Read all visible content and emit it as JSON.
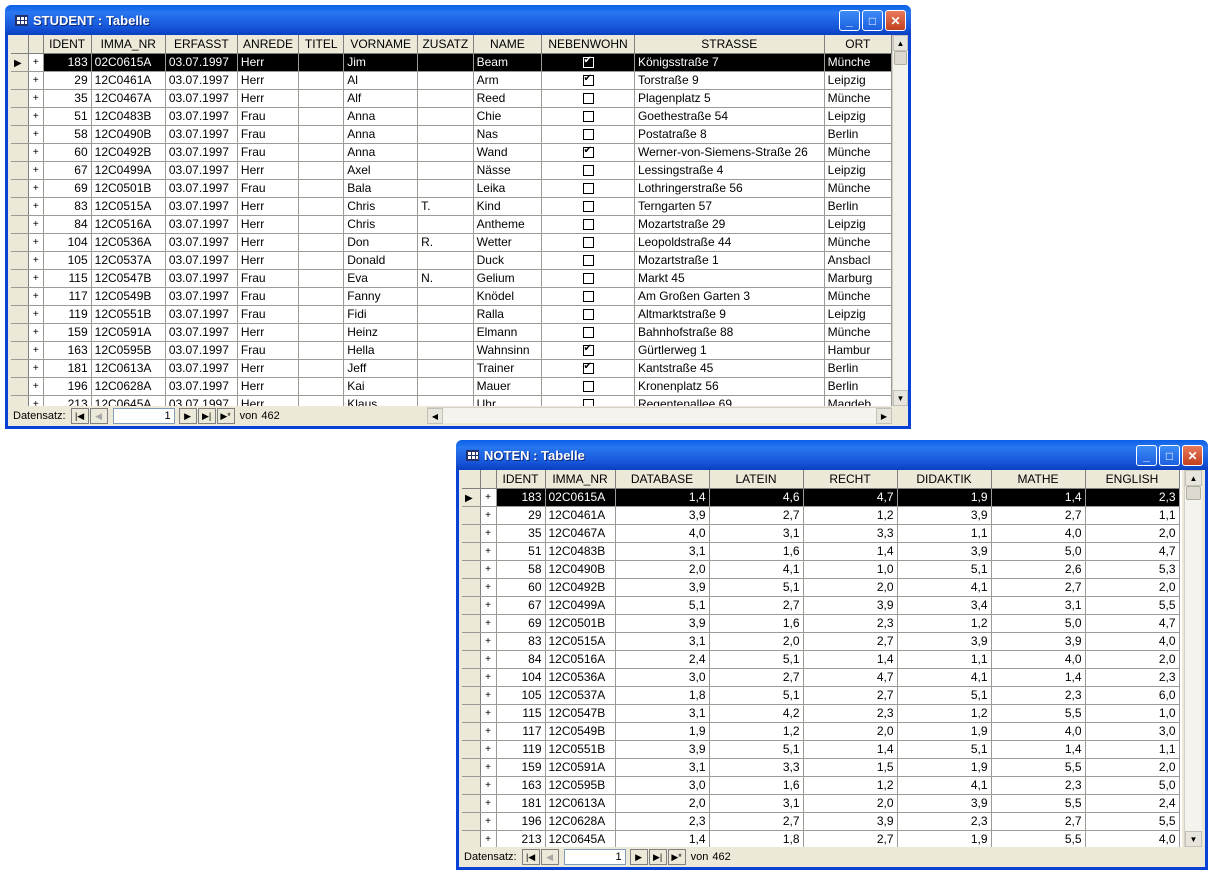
{
  "student": {
    "title": "STUDENT : Tabelle",
    "columns": [
      "IDENT",
      "IMMA_NR",
      "ERFASST",
      "ANREDE",
      "TITEL",
      "VORNAME",
      "ZUSATZ",
      "NAME",
      "NEBENWOHN",
      "STRASSE",
      "ORT"
    ],
    "rows": [
      [
        "183",
        "02C0615A",
        "03.07.1997",
        "Herr",
        "",
        "Jim",
        "",
        "Beam",
        true,
        "Königsstraße 7",
        "Münche"
      ],
      [
        "29",
        "12C0461A",
        "03.07.1997",
        "Herr",
        "",
        "Al",
        "",
        "Arm",
        true,
        "Torstraße 9",
        "Leipzig"
      ],
      [
        "35",
        "12C0467A",
        "03.07.1997",
        "Herr",
        "",
        "Alf",
        "",
        "Reed",
        false,
        "Plagenplatz 5",
        "Münche"
      ],
      [
        "51",
        "12C0483B",
        "03.07.1997",
        "Frau",
        "",
        "Anna",
        "",
        "Chie",
        false,
        "Goethestraße 54",
        "Leipzig"
      ],
      [
        "58",
        "12C0490B",
        "03.07.1997",
        "Frau",
        "",
        "Anna",
        "",
        "Nas",
        false,
        "Postatraße 8",
        "Berlin"
      ],
      [
        "60",
        "12C0492B",
        "03.07.1997",
        "Frau",
        "",
        "Anna",
        "",
        "Wand",
        true,
        "Werner-von-Siemens-Straße 26",
        "Münche"
      ],
      [
        "67",
        "12C0499A",
        "03.07.1997",
        "Herr",
        "",
        "Axel",
        "",
        "Nässe",
        false,
        "Lessingstraße 4",
        "Leipzig"
      ],
      [
        "69",
        "12C0501B",
        "03.07.1997",
        "Frau",
        "",
        "Bala",
        "",
        "Leika",
        false,
        "Lothringerstraße 56",
        "Münche"
      ],
      [
        "83",
        "12C0515A",
        "03.07.1997",
        "Herr",
        "",
        "Chris",
        "T.",
        "Kind",
        false,
        "Terngarten 57",
        "Berlin"
      ],
      [
        "84",
        "12C0516A",
        "03.07.1997",
        "Herr",
        "",
        "Chris",
        "",
        "Antheme",
        false,
        "Mozartstraße 29",
        "Leipzig"
      ],
      [
        "104",
        "12C0536A",
        "03.07.1997",
        "Herr",
        "",
        "Don",
        "R.",
        "Wetter",
        false,
        "Leopoldstraße 44",
        "Münche"
      ],
      [
        "105",
        "12C0537A",
        "03.07.1997",
        "Herr",
        "",
        "Donald",
        "",
        "Duck",
        false,
        "Mozartstraße 1",
        "Ansbacl"
      ],
      [
        "115",
        "12C0547B",
        "03.07.1997",
        "Frau",
        "",
        "Eva",
        "N.",
        "Gelium",
        false,
        "Markt 45",
        "Marburg"
      ],
      [
        "117",
        "12C0549B",
        "03.07.1997",
        "Frau",
        "",
        "Fanny",
        "",
        "Knödel",
        false,
        "Am Großen Garten 3",
        "Münche"
      ],
      [
        "119",
        "12C0551B",
        "03.07.1997",
        "Frau",
        "",
        "Fidi",
        "",
        "Ralla",
        false,
        "Altmarktstraße 9",
        "Leipzig"
      ],
      [
        "159",
        "12C0591A",
        "03.07.1997",
        "Herr",
        "",
        "Heinz",
        "",
        "Elmann",
        false,
        "Bahnhofstraße 88",
        "Münche"
      ],
      [
        "163",
        "12C0595B",
        "03.07.1997",
        "Frau",
        "",
        "Hella",
        "",
        "Wahnsinn",
        true,
        "Gürtlerweg 1",
        "Hambur"
      ],
      [
        "181",
        "12C0613A",
        "03.07.1997",
        "Herr",
        "",
        "Jeff",
        "",
        "Trainer",
        true,
        "Kantstraße 45",
        "Berlin"
      ],
      [
        "196",
        "12C0628A",
        "03.07.1997",
        "Herr",
        "",
        "Kai",
        "",
        "Mauer",
        false,
        "Kronenplatz 56",
        "Berlin"
      ],
      [
        "213",
        "12C0645A",
        "03.07.1997",
        "Herr",
        "",
        "Klaus",
        "",
        "Uhr",
        false,
        "Regentenallee 69",
        "Magdeb"
      ]
    ],
    "nav": {
      "label": "Datensatz:",
      "record": "1",
      "of": "von",
      "total": "462"
    }
  },
  "noten": {
    "title": "NOTEN : Tabelle",
    "columns": [
      "IDENT",
      "IMMA_NR",
      "DATABASE",
      "LATEIN",
      "RECHT",
      "DIDAKTIK",
      "MATHE",
      "ENGLISH"
    ],
    "rows": [
      [
        "183",
        "02C0615A",
        "1,4",
        "4,6",
        "4,7",
        "1,9",
        "1,4",
        "2,3"
      ],
      [
        "29",
        "12C0461A",
        "3,9",
        "2,7",
        "1,2",
        "3,9",
        "2,7",
        "1,1"
      ],
      [
        "35",
        "12C0467A",
        "4,0",
        "3,1",
        "3,3",
        "1,1",
        "4,0",
        "2,0"
      ],
      [
        "51",
        "12C0483B",
        "3,1",
        "1,6",
        "1,4",
        "3,9",
        "5,0",
        "4,7"
      ],
      [
        "58",
        "12C0490B",
        "2,0",
        "4,1",
        "1,0",
        "5,1",
        "2,6",
        "5,3"
      ],
      [
        "60",
        "12C0492B",
        "3,9",
        "5,1",
        "2,0",
        "4,1",
        "2,7",
        "2,0"
      ],
      [
        "67",
        "12C0499A",
        "5,1",
        "2,7",
        "3,9",
        "3,4",
        "3,1",
        "5,5"
      ],
      [
        "69",
        "12C0501B",
        "3,9",
        "1,6",
        "2,3",
        "1,2",
        "5,0",
        "4,7"
      ],
      [
        "83",
        "12C0515A",
        "3,1",
        "2,0",
        "2,7",
        "3,9",
        "3,9",
        "4,0"
      ],
      [
        "84",
        "12C0516A",
        "2,4",
        "5,1",
        "1,4",
        "1,1",
        "4,0",
        "2,0"
      ],
      [
        "104",
        "12C0536A",
        "3,0",
        "2,7",
        "4,7",
        "4,1",
        "1,4",
        "2,3"
      ],
      [
        "105",
        "12C0537A",
        "1,8",
        "5,1",
        "2,7",
        "5,1",
        "2,3",
        "6,0"
      ],
      [
        "115",
        "12C0547B",
        "3,1",
        "4,2",
        "2,3",
        "1,2",
        "5,5",
        "1,0"
      ],
      [
        "117",
        "12C0549B",
        "1,9",
        "1,2",
        "2,0",
        "1,9",
        "4,0",
        "3,0"
      ],
      [
        "119",
        "12C0551B",
        "3,9",
        "5,1",
        "1,4",
        "5,1",
        "1,4",
        "1,1"
      ],
      [
        "159",
        "12C0591A",
        "3,1",
        "3,3",
        "1,5",
        "1,9",
        "5,5",
        "2,0"
      ],
      [
        "163",
        "12C0595B",
        "3,0",
        "1,6",
        "1,2",
        "4,1",
        "2,3",
        "5,0"
      ],
      [
        "181",
        "12C0613A",
        "2,0",
        "3,1",
        "2,0",
        "3,9",
        "5,5",
        "2,4"
      ],
      [
        "196",
        "12C0628A",
        "2,3",
        "2,7",
        "3,9",
        "2,3",
        "2,7",
        "5,5"
      ],
      [
        "213",
        "12C0645A",
        "1,4",
        "1,8",
        "2,7",
        "1,9",
        "5,5",
        "4,0"
      ]
    ],
    "nav": {
      "label": "Datensatz:",
      "record": "1",
      "of": "von",
      "total": "462"
    }
  },
  "colors": {
    "titlebar": "#0a5fe6",
    "window_face": "#ece9d8",
    "selected_row": "#000000"
  },
  "icons": {
    "minimize": "minimize-icon",
    "maximize": "maximize-icon",
    "close": "close-icon",
    "table": "table-icon"
  }
}
